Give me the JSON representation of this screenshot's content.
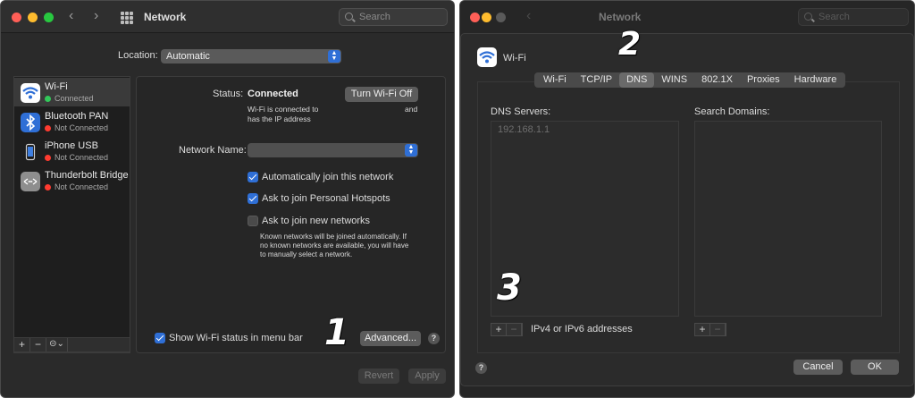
{
  "left_window": {
    "title": "Network",
    "search_placeholder": "Search",
    "location": {
      "label": "Location:",
      "value": "Automatic"
    },
    "services": [
      {
        "name": "Wi-Fi",
        "status": "Connected",
        "status_color": "#32c85a",
        "icon": "wifi-icon",
        "icon_color": "#2f6fd6",
        "selected": true
      },
      {
        "name": "Bluetooth PAN",
        "status": "Not Connected",
        "status_color": "#ff3b30",
        "icon": "bluetooth-icon",
        "icon_color": "#2f6fd6",
        "selected": false
      },
      {
        "name": "iPhone USB",
        "status": "Not Connected",
        "status_color": "#ff3b30",
        "icon": "iphone-icon",
        "icon_color": "#1e1e1e",
        "selected": false
      },
      {
        "name": "Thunderbolt Bridge",
        "status": "Not Connected",
        "status_color": "#ff3b30",
        "icon": "thunderbolt-bridge-icon",
        "icon_color": "#8e8e8e",
        "selected": false
      }
    ],
    "sidebar_buttons": [
      "+",
      "−",
      "⊝⌄"
    ],
    "status": {
      "label": "Status:",
      "value": "Connected",
      "turn_off_button": "Turn Wi-Fi Off",
      "description_line1": "Wi-Fi is connected to",
      "description_line2": "has the IP address",
      "description_and": "and"
    },
    "network_name_label": "Network Name:",
    "network_name_value": "",
    "checkboxes": [
      {
        "label": "Automatically join this network",
        "checked": true
      },
      {
        "label": "Ask to join Personal Hotspots",
        "checked": true
      },
      {
        "label": "Ask to join new networks",
        "checked": false
      }
    ],
    "known_networks_note": [
      "Known networks will be joined automatically. If",
      "no known networks are available, you will have",
      "to manually select a network."
    ],
    "show_status_label": "Show Wi-Fi status in menu bar",
    "advanced_button": "Advanced...",
    "help": "?",
    "revert_button": "Revert",
    "apply_button": "Apply",
    "annotation": "1"
  },
  "right_window": {
    "title": "Network",
    "search_placeholder": "Search",
    "service_name": "Wi-Fi",
    "tabs": [
      "Wi-Fi",
      "TCP/IP",
      "DNS",
      "WINS",
      "802.1X",
      "Proxies",
      "Hardware"
    ],
    "selected_tab": "DNS",
    "dns_servers_label": "DNS Servers:",
    "dns_servers": [
      "192.168.1.1"
    ],
    "search_domains_label": "Search Domains:",
    "address_hint": "IPv4 or IPv6 addresses",
    "help": "?",
    "cancel_button": "Cancel",
    "ok_button": "OK",
    "annotation_tabs": "2",
    "annotation_dns": "3"
  }
}
